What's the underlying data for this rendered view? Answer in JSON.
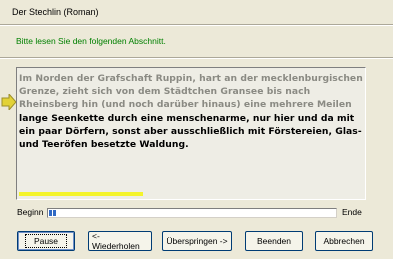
{
  "window": {
    "title": "Der Stechlin (Roman)",
    "instruction": "Bitte lesen Sie den folgenden Abschnitt."
  },
  "reading": {
    "read_text": "Im Norden der Grafschaft Ruppin, hart an der mecklenburgischen Grenze, zieht sich von dem Städtchen Gransee bis nach Rheinsberg hin (und noch darüber hinaus) eine mehrere Meilen",
    "unread_text": "lange Seenkette durch eine menschenarme, nur hier und da mit ein paar Dörfern, sonst aber ausschließlich mit Förstereien, Glas- und Teeröfen besetzte Waldung."
  },
  "progress": {
    "begin_label": "Beginn",
    "end_label": "Ende",
    "value_percent": 2
  },
  "buttons": {
    "pause": "Pause",
    "repeat": "<- Wiederholen",
    "skip": "Überspringen ->",
    "finish": "Beenden",
    "cancel": "Abbrechen"
  },
  "colors": {
    "background": "#ECE9D8",
    "instruction": "#008000",
    "read_text": "#8A8A83",
    "highlight": "#F4F42A",
    "progress": "#316AC5"
  },
  "icons": {
    "pointer": "yellow-arrow-right"
  }
}
